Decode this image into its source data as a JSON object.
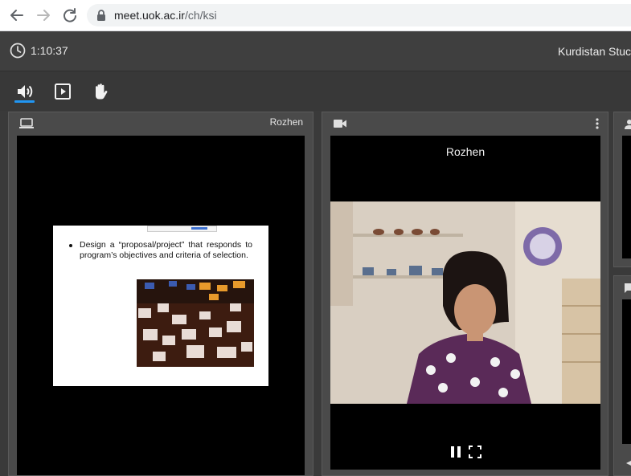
{
  "browser": {
    "url_host": "meet.uok.ac.ir",
    "url_path": "/ch/ksi"
  },
  "header": {
    "timer": "1:10:37",
    "org_title": "Kurdistan Stuc"
  },
  "toolbar": {
    "active_tool": "audio"
  },
  "screen_panel": {
    "presenter_label": "Rozhen",
    "slide": {
      "bullet": "Design a “proposal/project” that responds to program’s objectives and criteria of selection."
    }
  },
  "video_panel": {
    "participant_name": "Rozhen"
  },
  "colors": {
    "accent": "#2196f3",
    "panel_bg": "#4a4a4a",
    "app_bg": "#3a3a3a"
  }
}
